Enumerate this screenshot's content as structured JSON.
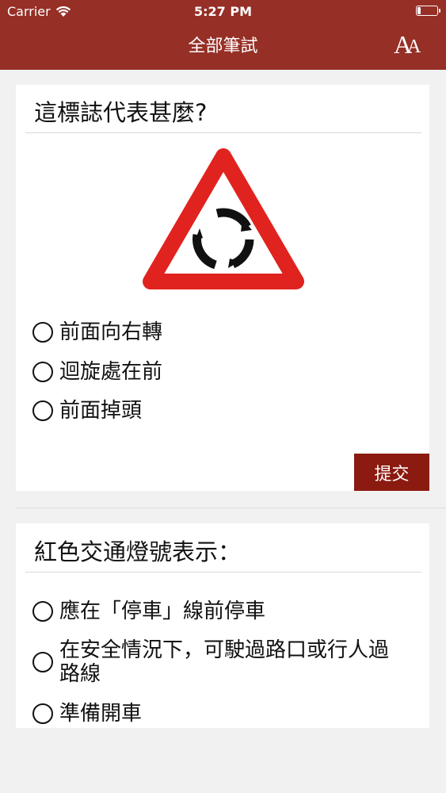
{
  "status": {
    "carrier": "Carrier",
    "time": "5:27 PM"
  },
  "nav": {
    "title": "全部筆試",
    "font_big": "A",
    "font_small": "A"
  },
  "questions": [
    {
      "title": "這標誌代表甚麼?",
      "options": [
        "前面向右轉",
        "迴旋處在前",
        "前面掉頭"
      ],
      "submit_label": "提交"
    },
    {
      "title": "紅色交通燈號表示：",
      "options": [
        "應在「停車」線前停車",
        "在安全情況下，可駛過路口或行人過路線",
        "準備開車"
      ]
    }
  ],
  "colors": {
    "bar": "#962f26",
    "submit": "#8b1a10",
    "sign_red": "#e0231f"
  }
}
